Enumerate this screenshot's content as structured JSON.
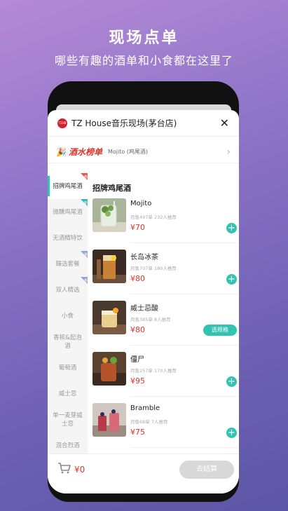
{
  "promo": {
    "title": "现场点单",
    "subtitle": "哪些有趣的酒单和小食都在这里了"
  },
  "header": {
    "logo_text": "TZHB",
    "store_name": "TZ House音乐现场(茅台店)",
    "close_icon": "close-icon"
  },
  "banner": {
    "icon": "party-popper-icon",
    "title": "酒水榜单",
    "desc": "Mojito (鸡尾酒)",
    "arrow": "›"
  },
  "sidebar": {
    "items": [
      {
        "label": "招牌鸡尾酒",
        "active": true,
        "badge": "热",
        "badge_color": "#e8584a"
      },
      {
        "label": "微醺鸡尾酒",
        "active": false,
        "badge": "新",
        "badge_color": "#33b7b3"
      },
      {
        "label": "无酒精特饮",
        "active": false,
        "badge": "",
        "badge_color": ""
      },
      {
        "label": "臻选套餐",
        "active": false,
        "badge": "惠",
        "badge_color": "#8fa4d6"
      },
      {
        "label": "双人精选",
        "active": false,
        "badge": "惠",
        "badge_color": "#8fa4d6"
      },
      {
        "label": "小食",
        "active": false,
        "badge": "",
        "badge_color": ""
      },
      {
        "label": "香槟&起泡酒",
        "active": false,
        "badge": "",
        "badge_color": ""
      },
      {
        "label": "葡萄酒",
        "active": false,
        "badge": "",
        "badge_color": ""
      },
      {
        "label": "威士忌",
        "active": false,
        "badge": "",
        "badge_color": ""
      },
      {
        "label": "单一麦芽威士忌",
        "active": false,
        "badge": "",
        "badge_color": ""
      },
      {
        "label": "混合烈酒",
        "active": false,
        "badge": "",
        "badge_color": ""
      }
    ]
  },
  "main": {
    "section_title": "招牌鸡尾酒",
    "items": [
      {
        "name": "Mojito",
        "meta": "月售497单  232人推荐",
        "price": "¥70",
        "action": "+"
      },
      {
        "name": "长岛冰茶",
        "meta": "月售707单  180人推荐",
        "price": "¥80",
        "action": "+"
      },
      {
        "name": "威士忌酸",
        "meta": "月售385单  8人推荐",
        "price": "¥80",
        "action": "选规格"
      },
      {
        "name": "僵尸",
        "meta": "月售257单  170人推荐",
        "price": "¥95",
        "action": "+"
      },
      {
        "name": "Bramble",
        "meta": "月售68单  7人推荐",
        "price": "¥75",
        "action": "+"
      }
    ]
  },
  "footer": {
    "cart_icon": "cart-icon",
    "total": "¥0",
    "checkout_label": "去结算"
  }
}
